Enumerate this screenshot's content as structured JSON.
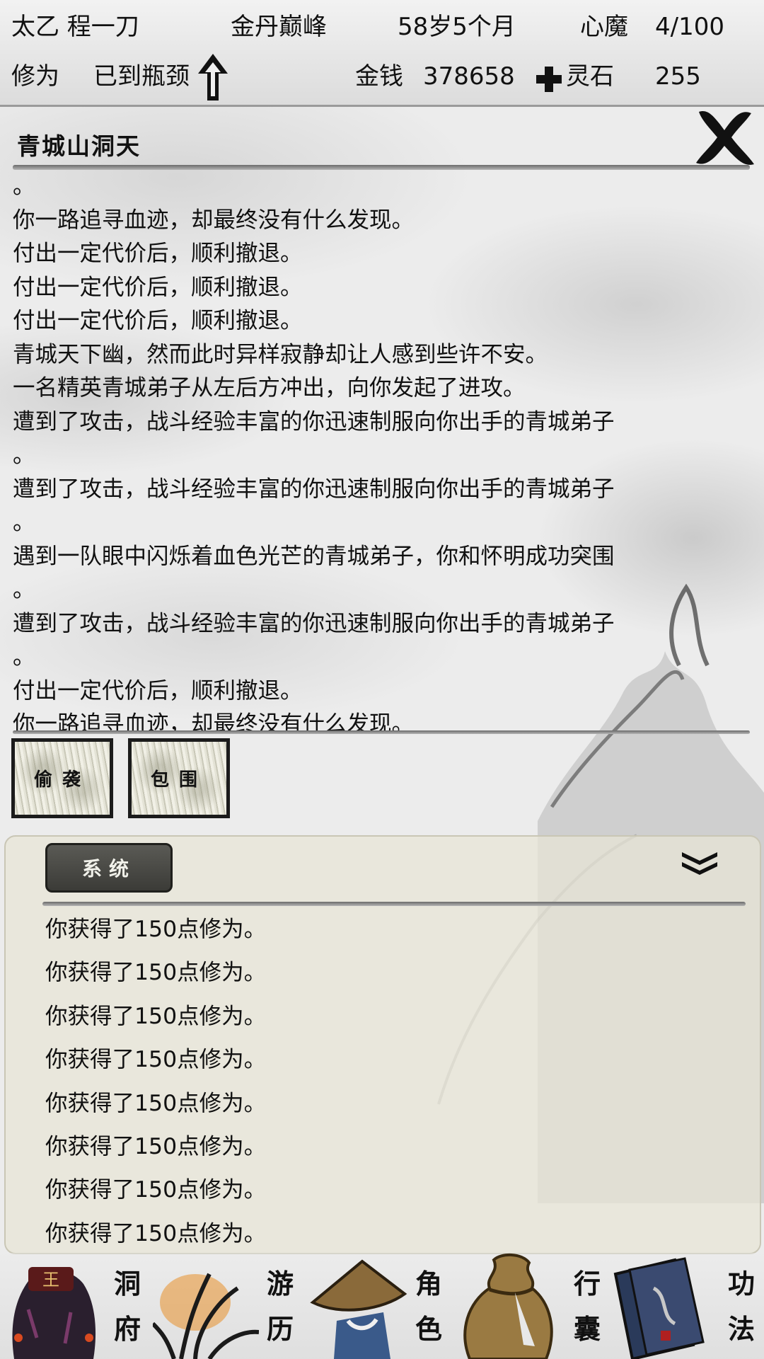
{
  "status": {
    "name": "太乙 程一刀",
    "realm": "金丹巅峰",
    "age": "58岁5个月",
    "heart_demon_label": "心魔",
    "heart_demon_value": "4/100",
    "cultivation_label": "修为",
    "cultivation_value": "已到瓶颈",
    "money_label": "金钱",
    "money_value": "378658",
    "spirit_stone_label": "灵石",
    "spirit_stone_value": "255"
  },
  "panel": {
    "title": "青城山洞天",
    "close_icon": "close-x-icon",
    "log": [
      "。",
      "你一路追寻血迹，却最终没有什么发现。",
      "付出一定代价后，顺利撤退。",
      "付出一定代价后，顺利撤退。",
      "付出一定代价后，顺利撤退。",
      "青城天下幽，然而此时异样寂静却让人感到些许不安。",
      "一名精英青城弟子从左后方冲出，向你发起了进攻。",
      "遭到了攻击，战斗经验丰富的你迅速制服向你出手的青城弟子",
      "。",
      "遭到了攻击，战斗经验丰富的你迅速制服向你出手的青城弟子",
      "。",
      "遇到一队眼中闪烁着血色光芒的青城弟子，你和怀明成功突围",
      "。",
      "遭到了攻击，战斗经验丰富的你迅速制服向你出手的青城弟子",
      "。",
      "付出一定代价后，顺利撤退。",
      "你一路追寻血迹，却最终没有什么发现。"
    ],
    "actions": [
      "偷袭",
      "包围"
    ]
  },
  "system": {
    "tab_label": "系统",
    "collapse_icon": "double-chevron-down-icon",
    "messages": [
      "你获得了150点修为。",
      "你获得了150点修为。",
      "你获得了150点修为。",
      "你获得了150点修为。",
      "你获得了150点修为。",
      "你获得了150点修为。",
      "你获得了150点修为。",
      "你获得了150点修为。"
    ]
  },
  "nav": [
    {
      "label_top": "洞",
      "label_bottom": "府",
      "icon": "cave-mansion-icon"
    },
    {
      "label_top": "游",
      "label_bottom": "历",
      "icon": "travel-grass-icon"
    },
    {
      "label_top": "角",
      "label_bottom": "色",
      "icon": "character-hat-icon"
    },
    {
      "label_top": "行",
      "label_bottom": "囊",
      "icon": "bag-icon"
    },
    {
      "label_top": "功",
      "label_bottom": "法",
      "icon": "skill-books-icon"
    }
  ],
  "colors": {
    "ink": "#111111",
    "paper": "#e8e5d6",
    "tab_dark": "#4a4a46",
    "highlight": "#e8902a"
  }
}
